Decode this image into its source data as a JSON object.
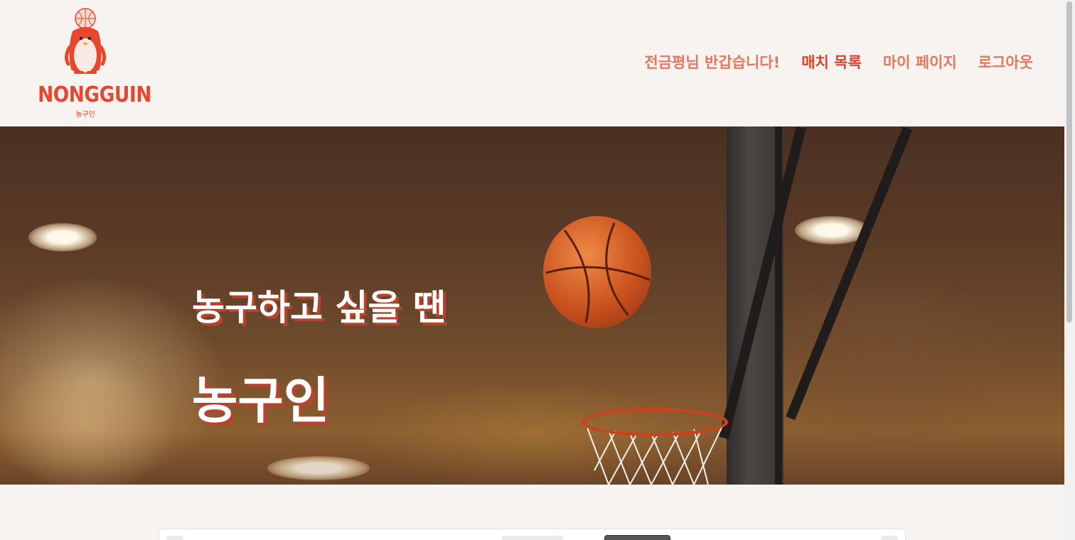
{
  "logo": {
    "name": "NONGGUIN",
    "subtitle": "농구인"
  },
  "nav": {
    "greeting": "전금평님 반갑습니다!",
    "items": [
      {
        "label": "매치 목록",
        "active": true
      },
      {
        "label": "마이 페이지",
        "active": false
      },
      {
        "label": "로그아웃",
        "active": false
      }
    ]
  },
  "hero": {
    "line1": "농구하고 싶을 땐",
    "line2": "농구인"
  },
  "colors": {
    "brand": "#e8472e",
    "nav_text": "#e8765e",
    "background": "#f6f3f1"
  }
}
